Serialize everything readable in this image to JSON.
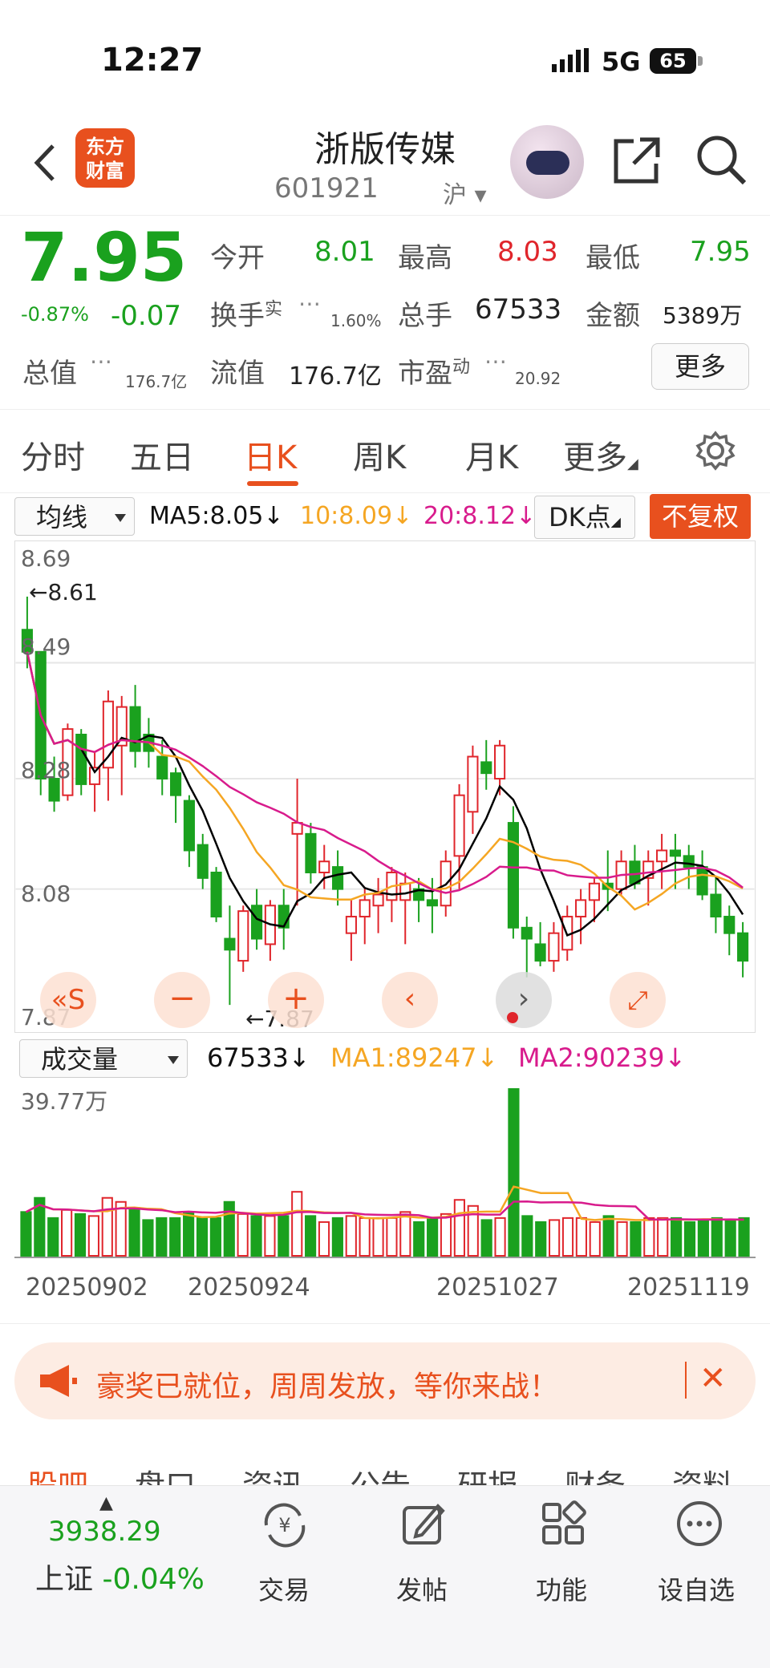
{
  "status_bar": {
    "time": "12:27",
    "network": "5G",
    "battery": "65"
  },
  "header": {
    "logo_line1": "东方",
    "logo_line2": "财富",
    "title": "浙版传媒",
    "code": "601921",
    "exchange": "沪"
  },
  "quote": {
    "price": "7.95",
    "change_pct": "-0.87%",
    "change": "-0.07",
    "open_label": "今开",
    "open": "8.01",
    "high_label": "最高",
    "high": "8.03",
    "low_label": "最低",
    "low": "7.95",
    "turnover_label": "换手",
    "turnover_sup": "实",
    "turnover": "1.60%",
    "volume_label": "总手",
    "volume": "67533",
    "amount_label": "金额",
    "amount": "5389万",
    "mktcap_label": "总值",
    "mktcap": "176.7亿",
    "float_label": "流值",
    "float": "176.7亿",
    "pe_label": "市盈",
    "pe_sup": "动",
    "pe": "20.92",
    "more": "更多"
  },
  "tabs": [
    "分时",
    "五日",
    "日K",
    "周K",
    "月K",
    "更多"
  ],
  "active_tab": "日K",
  "ma_bar": {
    "select": "均线",
    "ma5": "MA5:8.05",
    "ma10": "10:8.09",
    "ma20": "20:8.12",
    "dk": "DK点",
    "fq": "不复权"
  },
  "chart_labels": {
    "y_top": "8.69",
    "y1": "8.49",
    "y2": "8.28",
    "y3": "8.08",
    "y_bottom": "7.87",
    "hi_mark": "8.61",
    "lo_mark": "7.87"
  },
  "volume_bar": {
    "select": "成交量",
    "vol": "67533",
    "ma1": "MA1:89247",
    "ma2": "MA2:90239",
    "max": "39.77万"
  },
  "dates": [
    "20250902",
    "20250924",
    "20251027",
    "20251119"
  ],
  "banner": {
    "text": "豪奖已就位，周周发放，等你来战！"
  },
  "sub_tabs": [
    "股吧",
    "盘口",
    "资讯",
    "公告",
    "研报",
    "财务",
    "资料"
  ],
  "bottom_bar": {
    "index_value": "3938.29",
    "index_name": "上证",
    "index_pct": "-0.04%",
    "trade": "交易",
    "post": "发帖",
    "func": "功能",
    "watch": "设自选"
  },
  "colors": {
    "up": "#e0252b",
    "down": "#1aa11e",
    "accent": "#e8501e",
    "ma5": "#000000",
    "ma10": "#f5a623",
    "ma20": "#d81b8c"
  },
  "chart_data": {
    "type": "candlestick",
    "y_range": [
      7.87,
      8.69
    ],
    "candles": [
      [
        8.55,
        8.61,
        8.48,
        8.51
      ],
      [
        8.51,
        8.45,
        8.25,
        8.28
      ],
      [
        8.28,
        8.32,
        8.22,
        8.24
      ],
      [
        8.25,
        8.38,
        8.24,
        8.37
      ],
      [
        8.36,
        8.37,
        8.25,
        8.27
      ],
      [
        8.27,
        8.33,
        8.22,
        8.3
      ],
      [
        8.3,
        8.44,
        8.24,
        8.42
      ],
      [
        8.34,
        8.43,
        8.25,
        8.41
      ],
      [
        8.41,
        8.45,
        8.3,
        8.33
      ],
      [
        8.36,
        8.39,
        8.3,
        8.33
      ],
      [
        8.32,
        8.35,
        8.25,
        8.28
      ],
      [
        8.29,
        8.3,
        8.2,
        8.25
      ],
      [
        8.24,
        8.25,
        8.12,
        8.15
      ],
      [
        8.16,
        8.18,
        8.08,
        8.1
      ],
      [
        8.11,
        8.12,
        8.02,
        8.03
      ],
      [
        7.99,
        8.05,
        7.87,
        7.97
      ],
      [
        7.95,
        8.05,
        7.93,
        8.04
      ],
      [
        8.05,
        8.08,
        7.97,
        7.99
      ],
      [
        7.98,
        8.06,
        7.95,
        8.05
      ],
      [
        8.05,
        8.08,
        7.97,
        8.01
      ],
      [
        8.18,
        8.28,
        8.05,
        8.2
      ],
      [
        8.18,
        8.2,
        8.09,
        8.11
      ],
      [
        8.11,
        8.16,
        8.08,
        8.13
      ],
      [
        8.12,
        8.15,
        8.05,
        8.08
      ],
      [
        8.0,
        8.06,
        7.95,
        8.03
      ],
      [
        8.03,
        8.08,
        7.98,
        8.06
      ],
      [
        8.05,
        8.1,
        8.0,
        8.07
      ],
      [
        8.06,
        8.12,
        8.02,
        8.11
      ],
      [
        8.06,
        8.11,
        7.98,
        8.09
      ],
      [
        8.08,
        8.1,
        8.02,
        8.06
      ],
      [
        8.06,
        8.1,
        8.0,
        8.05
      ],
      [
        8.05,
        8.15,
        8.03,
        8.13
      ],
      [
        8.14,
        8.27,
        8.08,
        8.25
      ],
      [
        8.22,
        8.34,
        8.18,
        8.32
      ],
      [
        8.31,
        8.35,
        8.26,
        8.29
      ],
      [
        8.28,
        8.35,
        8.25,
        8.34
      ],
      [
        8.2,
        8.23,
        7.99,
        8.01
      ],
      [
        8.01,
        8.03,
        7.92,
        7.99
      ],
      [
        7.98,
        8.02,
        7.94,
        7.95
      ],
      [
        7.95,
        8.02,
        7.93,
        8.0
      ],
      [
        7.97,
        8.05,
        7.95,
        8.03
      ],
      [
        8.03,
        8.08,
        7.98,
        8.06
      ],
      [
        8.06,
        8.1,
        8.02,
        8.09
      ],
      [
        8.09,
        8.15,
        8.04,
        8.08
      ],
      [
        8.08,
        8.15,
        8.07,
        8.13
      ],
      [
        8.13,
        8.16,
        8.08,
        8.09
      ],
      [
        8.1,
        8.15,
        8.05,
        8.13
      ],
      [
        8.13,
        8.18,
        8.08,
        8.15
      ],
      [
        8.15,
        8.18,
        8.08,
        8.14
      ],
      [
        8.14,
        8.16,
        8.08,
        8.12
      ],
      [
        8.12,
        8.15,
        8.06,
        8.07
      ],
      [
        8.07,
        8.1,
        8.0,
        8.03
      ],
      [
        8.03,
        8.05,
        7.96,
        8.0
      ],
      [
        8.0,
        8.02,
        7.92,
        7.95
      ]
    ],
    "volume_max": 39.77
  }
}
